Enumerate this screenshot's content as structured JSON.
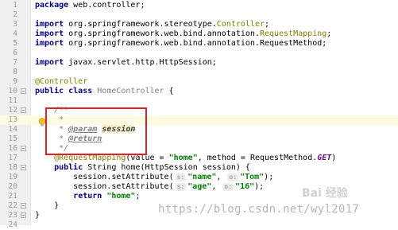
{
  "editor": {
    "lines": [
      {
        "n": "1",
        "segs": [
          {
            "c": "kw",
            "t": "package"
          },
          {
            "c": "",
            "t": " web.controller;"
          }
        ]
      },
      {
        "n": "2",
        "segs": []
      },
      {
        "n": "3",
        "segs": [
          {
            "c": "kw",
            "t": "import"
          },
          {
            "c": "",
            "t": " org.springframework.stereotype."
          },
          {
            "c": "ann-str",
            "t": "Controller"
          },
          {
            "c": "",
            "t": ";"
          }
        ]
      },
      {
        "n": "4",
        "segs": [
          {
            "c": "kw",
            "t": "import"
          },
          {
            "c": "",
            "t": " org.springframework.web.bind.annotation."
          },
          {
            "c": "ann-str",
            "t": "RequestMapping"
          },
          {
            "c": "",
            "t": ";"
          }
        ]
      },
      {
        "n": "5",
        "segs": [
          {
            "c": "kw",
            "t": "import"
          },
          {
            "c": "",
            "t": " org.springframework.web.bind.annotation.RequestMethod;"
          }
        ]
      },
      {
        "n": "6",
        "segs": []
      },
      {
        "n": "7",
        "segs": [
          {
            "c": "kw",
            "t": "import"
          },
          {
            "c": "",
            "t": " javax.servlet.http.HttpSession;"
          }
        ]
      },
      {
        "n": "8",
        "segs": []
      },
      {
        "n": "9",
        "segs": [
          {
            "c": "ann",
            "t": "@Controller"
          }
        ]
      },
      {
        "n": "10",
        "segs": [
          {
            "c": "kw",
            "t": "public class"
          },
          {
            "c": "",
            "t": " "
          },
          {
            "c": "com-n",
            "t": "HomeController"
          },
          {
            "c": "",
            "t": " {"
          }
        ]
      },
      {
        "n": "11",
        "segs": []
      },
      {
        "n": "12",
        "segs": [
          {
            "c": "",
            "t": "    "
          },
          {
            "c": "com",
            "t": "/**"
          }
        ]
      },
      {
        "n": "13",
        "segs": [
          {
            "c": "",
            "t": "     "
          },
          {
            "c": "com",
            "t": "*"
          }
        ]
      },
      {
        "n": "14",
        "segs": [
          {
            "c": "",
            "t": "     "
          },
          {
            "c": "com",
            "t": "* "
          },
          {
            "c": "jdtag",
            "t": "@param"
          },
          {
            "c": "",
            "t": " "
          },
          {
            "c": "jdparam",
            "t": "session"
          }
        ]
      },
      {
        "n": "15",
        "segs": [
          {
            "c": "",
            "t": "     "
          },
          {
            "c": "com",
            "t": "* "
          },
          {
            "c": "jdtag",
            "t": "@return"
          }
        ]
      },
      {
        "n": "16",
        "segs": [
          {
            "c": "",
            "t": "     "
          },
          {
            "c": "com",
            "t": "*/"
          }
        ]
      },
      {
        "n": "17",
        "segs": [
          {
            "c": "",
            "t": "    "
          },
          {
            "c": "ann",
            "t": "@RequestMapping"
          },
          {
            "c": "",
            "t": "(value = "
          },
          {
            "c": "str",
            "t": "\"home\""
          },
          {
            "c": "",
            "t": ", method = RequestMethod."
          },
          {
            "c": "const",
            "t": "GET"
          },
          {
            "c": "",
            "t": ")"
          }
        ]
      },
      {
        "n": "18",
        "segs": [
          {
            "c": "",
            "t": "    "
          },
          {
            "c": "kw",
            "t": "public"
          },
          {
            "c": "",
            "t": " String home(HttpSession session) {"
          }
        ]
      },
      {
        "n": "19",
        "segs": [
          {
            "c": "",
            "t": "        session.setAttribute("
          },
          {
            "c": "hint",
            "t": "s:"
          },
          {
            "c": "str",
            "t": "\"name\""
          },
          {
            "c": "",
            "t": ", "
          },
          {
            "c": "hint",
            "t": "o:"
          },
          {
            "c": "str",
            "t": "\"Tom\""
          },
          {
            "c": "",
            "t": ");"
          }
        ]
      },
      {
        "n": "20",
        "segs": [
          {
            "c": "",
            "t": "        session.setAttribute("
          },
          {
            "c": "hint",
            "t": "s:"
          },
          {
            "c": "str",
            "t": "\"age\""
          },
          {
            "c": "",
            "t": ", "
          },
          {
            "c": "hint",
            "t": "o:"
          },
          {
            "c": "str",
            "t": "\"16\""
          },
          {
            "c": "",
            "t": ");"
          }
        ]
      },
      {
        "n": "21",
        "segs": [
          {
            "c": "",
            "t": "        "
          },
          {
            "c": "kw",
            "t": "return"
          },
          {
            "c": "",
            "t": " "
          },
          {
            "c": "str",
            "t": "\"home\""
          },
          {
            "c": "",
            "t": ";"
          }
        ]
      },
      {
        "n": "22",
        "segs": [
          {
            "c": "",
            "t": "    }"
          }
        ]
      },
      {
        "n": "23",
        "segs": [
          {
            "c": "",
            "t": "}"
          }
        ]
      },
      {
        "n": "24",
        "segs": []
      }
    ]
  },
  "watermark": {
    "url_text": "https://blog.csdn.net/wyl2017",
    "logo_text": "Bai 经验"
  },
  "colors": {
    "highlight_box": "#e0212b",
    "current_line": "#fffbe3",
    "keyword": "#000080",
    "string": "#008000",
    "annotation": "#808000"
  }
}
